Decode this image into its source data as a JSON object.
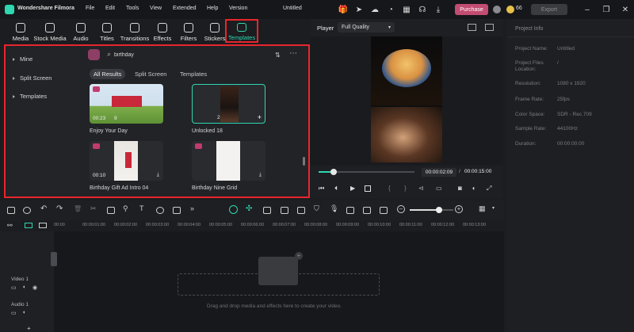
{
  "app": {
    "title": "Wondershare Filmora",
    "doc_title": "Untitled"
  },
  "menu": [
    "File",
    "Edit",
    "Tools",
    "View",
    "Extended",
    "Help",
    "Version"
  ],
  "purchase_label": "Purchase",
  "credits": "66",
  "export_label": "Export",
  "toolbar": [
    "Media",
    "Stock Media",
    "Audio",
    "Titles",
    "Transitions",
    "Effects",
    "Filters",
    "Stickers",
    "Templates"
  ],
  "sidebar": [
    "Mine",
    "Split Screen",
    "Templates"
  ],
  "search": {
    "value": "birthday"
  },
  "filters": [
    "All Results",
    "Split Screen",
    "Templates"
  ],
  "cards": [
    {
      "title": "Enjoy Your Day",
      "duration": "00:23",
      "count": "9"
    },
    {
      "title": "Unlocked 18",
      "duration": "",
      "count": "2"
    },
    {
      "title": "Birthday Gift Ad Intro 04",
      "duration": "00:10",
      "count": ""
    },
    {
      "title": "Birthday Nine Grid",
      "duration": "",
      "count": ""
    }
  ],
  "player": {
    "label": "Player",
    "quality": "Full Quality",
    "current": "00:00:02:09",
    "total": "00:00:15:00",
    "progress": 0.16
  },
  "project_info": {
    "header": "Project Info",
    "rows": [
      {
        "label": "Project Name:",
        "value": "Untitled"
      },
      {
        "label": "Project Files Location:",
        "value": "/"
      },
      {
        "label": "Resolution:",
        "value": "1080 x 1920"
      },
      {
        "label": "Frame Rate:",
        "value": "25fps"
      },
      {
        "label": "Color Space:",
        "value": "SDR - Rec.709"
      },
      {
        "label": "Sample Rate:",
        "value": "44100Hz"
      },
      {
        "label": "Duration:",
        "value": "00:00:00:00"
      }
    ]
  },
  "ruler_ticks": [
    "00:00",
    "00:00:01:00",
    "00:00:02:00",
    "00:00:03:00",
    "00:00:04:00",
    "00:00:05:00",
    "00:00:06:00",
    "00:00:07:00",
    "00:00:08:00",
    "00:00:09:00",
    "00:00:10:00",
    "00:00:11:00",
    "00:00:12:00",
    "00:00:13:00"
  ],
  "tracks": {
    "video": "Video 1",
    "audio": "Audio 1"
  },
  "drop_hint": "Drag and drop media and effects here to create your video.",
  "zoom": 0.68,
  "colors": {
    "accent": "#2fd6b0",
    "highlight": "#e8262c"
  }
}
